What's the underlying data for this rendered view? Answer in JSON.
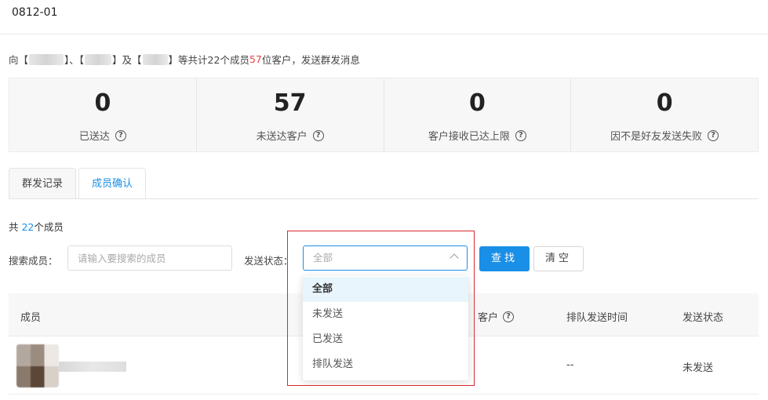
{
  "header": {
    "title": "0812-01"
  },
  "description": {
    "prefix": "向【",
    "sep1": "】、【",
    "sep2": "】及【",
    "middle": "】等共计22个成员",
    "customer_count": "57",
    "suffix": "位客户，发送群发消息"
  },
  "stats": [
    {
      "value": "0",
      "label": "已送达"
    },
    {
      "value": "57",
      "label": "未送达客户"
    },
    {
      "value": "0",
      "label": "客户接收已达上限"
    },
    {
      "value": "0",
      "label": "因不是好友发送失败"
    }
  ],
  "tabs": [
    {
      "label": "群发记录"
    },
    {
      "label": "成员确认"
    }
  ],
  "member_count": {
    "prefix": "共 ",
    "n": "22",
    "suffix": "个成员"
  },
  "filters": {
    "search_label": "搜索成员：",
    "search_placeholder": "请输入要搜索的成员",
    "status_label": "发送状态：",
    "status_value": "全部"
  },
  "buttons": {
    "search": "查找",
    "clear": "清空"
  },
  "dropdown": {
    "options": [
      "全部",
      "未发送",
      "已发送",
      "排队发送"
    ]
  },
  "table": {
    "columns": [
      "成员",
      "客户",
      "排队发送时间",
      "发送状态"
    ],
    "rows": [
      {
        "time": "--",
        "status": "未发送"
      }
    ]
  },
  "icons": {
    "help": "question-circle-icon",
    "chevron": "chevron-up-icon"
  },
  "colors": {
    "accent": "#1a8fe8",
    "highlight": "#d9282f",
    "number_red": "#e6453c"
  }
}
